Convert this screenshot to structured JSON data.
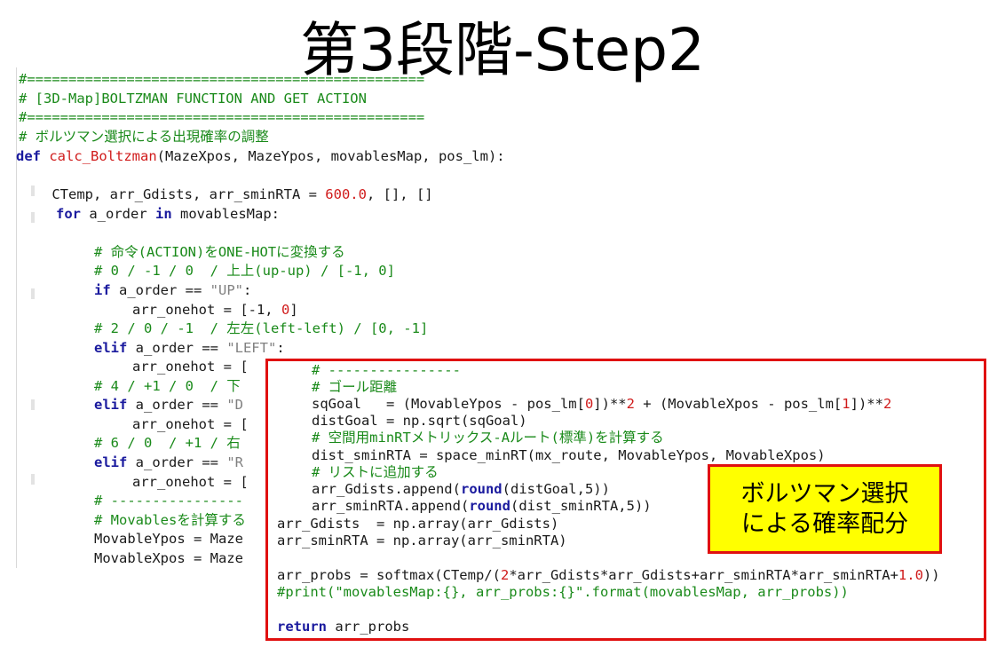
{
  "slide": {
    "title": "第3段階-Step2"
  },
  "code": {
    "line01": "#================================================",
    "line02": "# [3D-Map]BOLTZMAN FUNCTION AND GET ACTION",
    "line03": "#================================================",
    "line04": "# ボルツマン選択による出現確率の調整",
    "line05_kw": "def",
    "line05_fn": "calc_Boltzman",
    "line05_rest": "(MazeXpos, MazeYpos, movablesMap, pos_lm):",
    "line06_a": "    CTemp, arr_Gdists, arr_sminRTA = ",
    "line06_num": "600.0",
    "line06_b": ", [], []",
    "line07_kw1": "for",
    "line07_mid": " a_order ",
    "line07_kw2": "in",
    "line07_rest": " movablesMap:",
    "line08": "# 命令(ACTION)をONE-HOTに変換する",
    "line09": "# 0 / -1 / 0  / 上上(up-up) / [-1, 0]",
    "line10_kw": "if",
    "line10_mid": " a_order == ",
    "line10_str": "\"UP\"",
    "line10_end": ":",
    "line11_a": "arr_onehot = [-1, ",
    "line11_num": "0",
    "line11_b": "]",
    "line12": "# 2 / 0 / -1  / 左左(left-left) / [0, -1]",
    "line13_kw": "elif",
    "line13_mid": " a_order == ",
    "line13_str": "\"LEFT\"",
    "line13_end": ":",
    "line14": "arr_onehot = [",
    "line15": "# 4 / +1 / 0  / 下",
    "line16_kw": "elif",
    "line16_mid": " a_order == ",
    "line16_str": "\"D",
    "line17": "arr_onehot = [",
    "line18": "# 6 / 0  / +1 / 右",
    "line19_kw": "elif",
    "line19_mid": " a_order == ",
    "line19_str": "\"R",
    "line20": "arr_onehot = [",
    "line21": "# ----------------",
    "line22": "# Movablesを計算する",
    "line23": "MovableYpos = Maze",
    "line24": "MovableXpos = Maze"
  },
  "overlay": {
    "o01": "# ----------------",
    "o02": "# ゴール距離",
    "o03_a": "sqGoal   = (MovableYpos - pos_lm[",
    "o03_n1": "0",
    "o03_b": "])**",
    "o03_n2": "2",
    "o03_c": " + (MovableXpos - pos_lm[",
    "o03_n3": "1",
    "o03_d": "])**",
    "o03_n4": "2",
    "o04": "distGoal = np.sqrt(sqGoal)",
    "o05": "# 空間用minRTメトリックス-Aルート(標準)を計算する",
    "o06": "dist_sminRTA = space_minRT(mx_route, MovableYpos, MovableXpos)",
    "o07": "# リストに追加する",
    "o08_a": "arr_Gdists.append(",
    "o08_kw": "round",
    "o08_b": "(distGoal,5))",
    "o09_a": "arr_sminRTA.append(",
    "o09_kw": "round",
    "o09_b": "(dist_sminRTA,5))",
    "o10": "arr_Gdists  = np.array(arr_Gdists)",
    "o11": "arr_sminRTA = np.array(arr_sminRTA)",
    "o12_a": "arr_probs = softmax(CTemp/(",
    "o12_n1": "2",
    "o12_b": "*arr_Gdists*arr_Gdists+arr_sminRTA*arr_sminRTA+",
    "o12_n2": "1.0",
    "o12_c": "))",
    "o13": "#print(\"movablesMap:{}, arr_probs:{}\".format(movablesMap, arr_probs))",
    "o14_kw": "return",
    "o14_rest": " arr_probs"
  },
  "note": {
    "text": "ボルツマン選択\nによる確率配分"
  },
  "colors": {
    "comment": "#1a8a1a",
    "keyword": "#1a1a9e",
    "function": "#d01b1b",
    "number": "#d01b1b",
    "string": "#808080",
    "highlight_border": "#e01010",
    "note_bg": "#ffff00"
  }
}
